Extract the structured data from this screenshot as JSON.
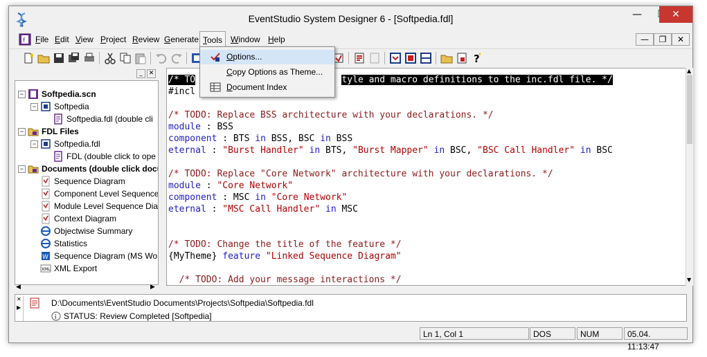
{
  "window": {
    "title": "EventStudio System Designer 6 - [Softpedia.fdl]"
  },
  "menu": {
    "items": [
      {
        "label": "File",
        "key": "F",
        "rest": "ile"
      },
      {
        "label": "Edit",
        "key": "E",
        "rest": "dit"
      },
      {
        "label": "View",
        "key": "V",
        "rest": "iew"
      },
      {
        "label": "Project",
        "key": "P",
        "rest": "roject"
      },
      {
        "label": "Review",
        "key": "R",
        "rest": "eview"
      },
      {
        "label": "Generate",
        "key": "G",
        "rest": "enerate"
      },
      {
        "label": "Tools",
        "key": "T",
        "rest": "ools"
      },
      {
        "label": "Window",
        "key": "W",
        "rest": "indow"
      },
      {
        "label": "Help",
        "key": "H",
        "rest": "elp"
      }
    ]
  },
  "tools_menu": {
    "items": [
      {
        "label": "Options...",
        "key": "O",
        "rest": "ptions...",
        "icon": "checkmark-icon"
      },
      {
        "label": "Copy Options as Theme...",
        "key": "C",
        "rest": "opy Options as Theme...",
        "icon": ""
      },
      {
        "label": "Document Index",
        "key": "D",
        "rest": "ocument Index",
        "icon": "table-icon"
      }
    ]
  },
  "tree": {
    "items": [
      {
        "label": "Softpedia.scn",
        "bold": true,
        "level": 0,
        "icon": "scenario-icon"
      },
      {
        "label": "Softpedia",
        "bold": false,
        "level": 1,
        "icon": "film-icon"
      },
      {
        "label": "Softpedia.fdl (double cli",
        "bold": false,
        "level": 2,
        "icon": "fdl-file-icon"
      },
      {
        "label": "FDL Files",
        "bold": true,
        "level": 0,
        "icon": "folder-icon"
      },
      {
        "label": "Softpedia.fdl",
        "bold": false,
        "level": 1,
        "icon": "film-icon"
      },
      {
        "label": "FDL (double click to ope",
        "bold": false,
        "level": 2,
        "icon": "fdl-file-icon"
      },
      {
        "label": "Documents (double click docu",
        "bold": true,
        "level": 0,
        "icon": "folder-icon"
      },
      {
        "label": "Sequence Diagram",
        "bold": false,
        "level": 1,
        "icon": "pdf-icon"
      },
      {
        "label": "Component Level Sequence",
        "bold": false,
        "level": 1,
        "icon": "pdf-icon"
      },
      {
        "label": "Module Level Sequence Dia",
        "bold": false,
        "level": 1,
        "icon": "pdf-icon"
      },
      {
        "label": "Context Diagram",
        "bold": false,
        "level": 1,
        "icon": "pdf-icon"
      },
      {
        "label": "Objectwise Summary",
        "bold": false,
        "level": 1,
        "icon": "ie-icon"
      },
      {
        "label": "Statistics",
        "bold": false,
        "level": 1,
        "icon": "ie-icon"
      },
      {
        "label": "Sequence Diagram (MS Wo",
        "bold": false,
        "level": 1,
        "icon": "word-icon"
      },
      {
        "label": "XML Export",
        "bold": false,
        "level": 1,
        "icon": "xml-icon"
      }
    ]
  },
  "editor": {
    "lines": [
      [
        {
          "t": "/* TO",
          "c": "hl"
        },
        {
          "t": "                           ",
          "c": "plain"
        },
        {
          "t": "tyle and macro definitions to the inc.fdl file. */",
          "c": "hl"
        }
      ],
      [
        {
          "t": "#incl",
          "c": "plain"
        }
      ],
      [],
      [
        {
          "t": "/* TODO: Replace BSS architecture with your declarations. */",
          "c": "com"
        }
      ],
      [
        {
          "t": "module",
          "c": "kw"
        },
        {
          "t": " : BSS",
          "c": "plain"
        }
      ],
      [
        {
          "t": "component",
          "c": "kw"
        },
        {
          "t": " : BTS ",
          "c": "plain"
        },
        {
          "t": "in",
          "c": "kw"
        },
        {
          "t": " BSS, BSC ",
          "c": "plain"
        },
        {
          "t": "in",
          "c": "kw"
        },
        {
          "t": " BSS",
          "c": "plain"
        }
      ],
      [
        {
          "t": "eternal",
          "c": "kw"
        },
        {
          "t": " : ",
          "c": "plain"
        },
        {
          "t": "\"Burst Handler\"",
          "c": "str"
        },
        {
          "t": " ",
          "c": "plain"
        },
        {
          "t": "in",
          "c": "kw"
        },
        {
          "t": " BTS, ",
          "c": "plain"
        },
        {
          "t": "\"Burst Mapper\"",
          "c": "str"
        },
        {
          "t": " ",
          "c": "plain"
        },
        {
          "t": "in",
          "c": "kw"
        },
        {
          "t": " BSC, ",
          "c": "plain"
        },
        {
          "t": "\"BSC Call Handler\"",
          "c": "str"
        },
        {
          "t": " ",
          "c": "plain"
        },
        {
          "t": "in",
          "c": "kw"
        },
        {
          "t": " BSC",
          "c": "plain"
        }
      ],
      [],
      [
        {
          "t": "/* TODO: Replace \"Core Network\" architecture with your declarations. */",
          "c": "com"
        }
      ],
      [
        {
          "t": "module",
          "c": "kw"
        },
        {
          "t": " : ",
          "c": "plain"
        },
        {
          "t": "\"Core Network\"",
          "c": "str"
        }
      ],
      [
        {
          "t": "component",
          "c": "kw"
        },
        {
          "t": " : MSC ",
          "c": "plain"
        },
        {
          "t": "in",
          "c": "kw"
        },
        {
          "t": " ",
          "c": "plain"
        },
        {
          "t": "\"Core Network\"",
          "c": "str"
        }
      ],
      [
        {
          "t": "eternal",
          "c": "kw"
        },
        {
          "t": " : ",
          "c": "plain"
        },
        {
          "t": "\"MSC Call Handler\"",
          "c": "str"
        },
        {
          "t": " ",
          "c": "plain"
        },
        {
          "t": "in",
          "c": "kw"
        },
        {
          "t": " MSC",
          "c": "plain"
        }
      ],
      [],
      [],
      [
        {
          "t": "/* TODO: Change the title of the feature */",
          "c": "com"
        }
      ],
      [
        {
          "t": "{MyTheme}",
          "c": "theme"
        },
        {
          "t": " ",
          "c": "plain"
        },
        {
          "t": "feature",
          "c": "kw"
        },
        {
          "t": " ",
          "c": "plain"
        },
        {
          "t": "\"Linked Sequence Diagram\"",
          "c": "str"
        }
      ],
      [],
      [
        {
          "t": "  /* TODO: Add your message interactions */",
          "c": "com"
        }
      ]
    ]
  },
  "output": {
    "path": "D:\\Documents\\EventStudio Documents\\Projects\\Softpedia\\Softpedia.fdl",
    "status": "STATUS: Review Completed [Softpedia]"
  },
  "statusbar": {
    "position": "Ln 1, Col 1",
    "line_ending": "DOS",
    "num": "NUM",
    "datetime": "05.04. 11:13:47"
  },
  "colors": {
    "keyword": "#2020c0",
    "comment": "#8b1a1a",
    "string": "#b00000",
    "close": "#c7372f"
  }
}
